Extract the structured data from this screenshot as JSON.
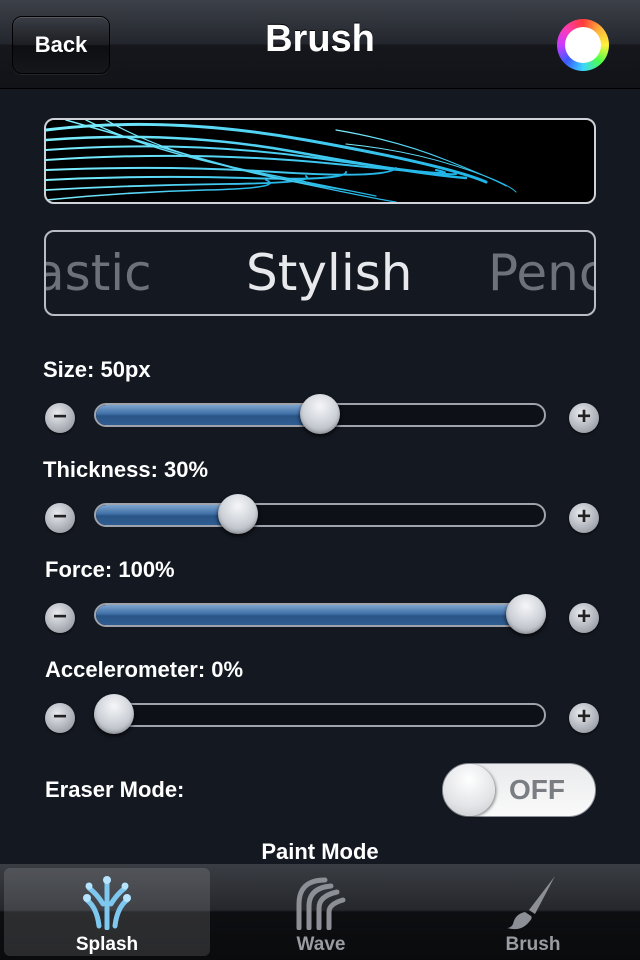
{
  "navbar": {
    "back_label": "Back",
    "title": "Brush",
    "color_icon": "color-wheel-icon"
  },
  "brush_picker": {
    "prev": "astic",
    "current": "Stylish",
    "next": "Penc"
  },
  "sliders": {
    "size": {
      "label": "Size: 50px",
      "value": 0.5,
      "minus_icon": "minus-icon",
      "plus_icon": "plus-icon"
    },
    "thickness": {
      "label": "Thickness: 30%",
      "value": 0.3
    },
    "force": {
      "label": "Force: 100%",
      "value": 1.0
    },
    "accelerometer": {
      "label": "Accelerometer: 0%",
      "value": 0.0
    }
  },
  "eraser": {
    "label": "Eraser Mode:",
    "state": "OFF"
  },
  "paint_mode_label": "Paint Mode",
  "tabs": [
    {
      "label": "Splash",
      "icon": "splash-icon",
      "active": true
    },
    {
      "label": "Wave",
      "icon": "wave-icon",
      "active": false
    },
    {
      "label": "Brush",
      "icon": "brush-icon",
      "active": false
    }
  ],
  "colors": {
    "accent_blue": "#2f5d92",
    "preview_stroke": "#35d8ff"
  }
}
